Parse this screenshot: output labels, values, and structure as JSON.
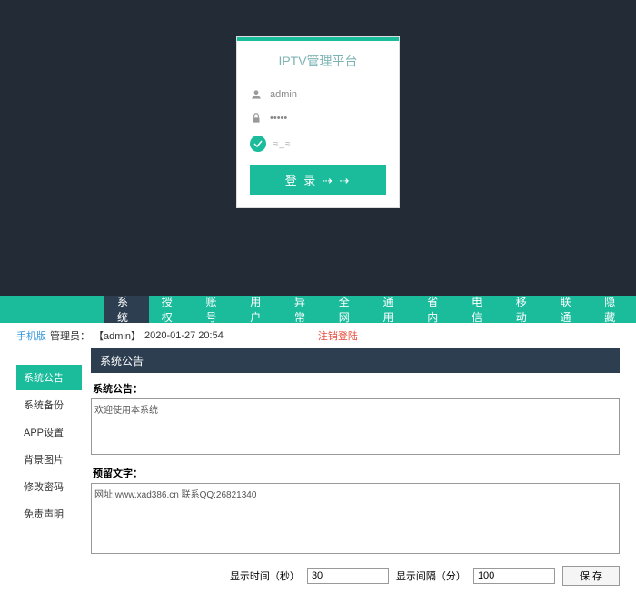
{
  "login": {
    "title": "IPTV管理平台",
    "username": "admin",
    "password": "·····",
    "captcha": "≈_≈",
    "button": "登 录 ⇢ ⇢"
  },
  "nav": {
    "items": [
      "系统",
      "授权",
      "账号",
      "用户",
      "异常",
      "全网",
      "通用",
      "省内",
      "电信",
      "移动",
      "联通",
      "隐藏"
    ]
  },
  "subbar": {
    "mobile": "手机版",
    "admin_label": "管理员：",
    "admin_user": "【admin】",
    "datetime": "2020-01-27 20:54",
    "logout": "注销登陆"
  },
  "sidebar": {
    "items": [
      "系统公告",
      "系统备份",
      "APP设置",
      "背景图片",
      "修改密码",
      "免责声明"
    ]
  },
  "panel": {
    "header": "系统公告",
    "announce_label": "系统公告：",
    "announce_value": "欢迎使用本系统",
    "reserve_label": "预留文字：",
    "reserve_value": "网址:www.xad386.cn 联系QQ:26821340",
    "time_label": "显示时间（秒）",
    "time_value": "30",
    "interval_label": "显示间隔（分）",
    "interval_value": "100",
    "save": "保 存"
  }
}
